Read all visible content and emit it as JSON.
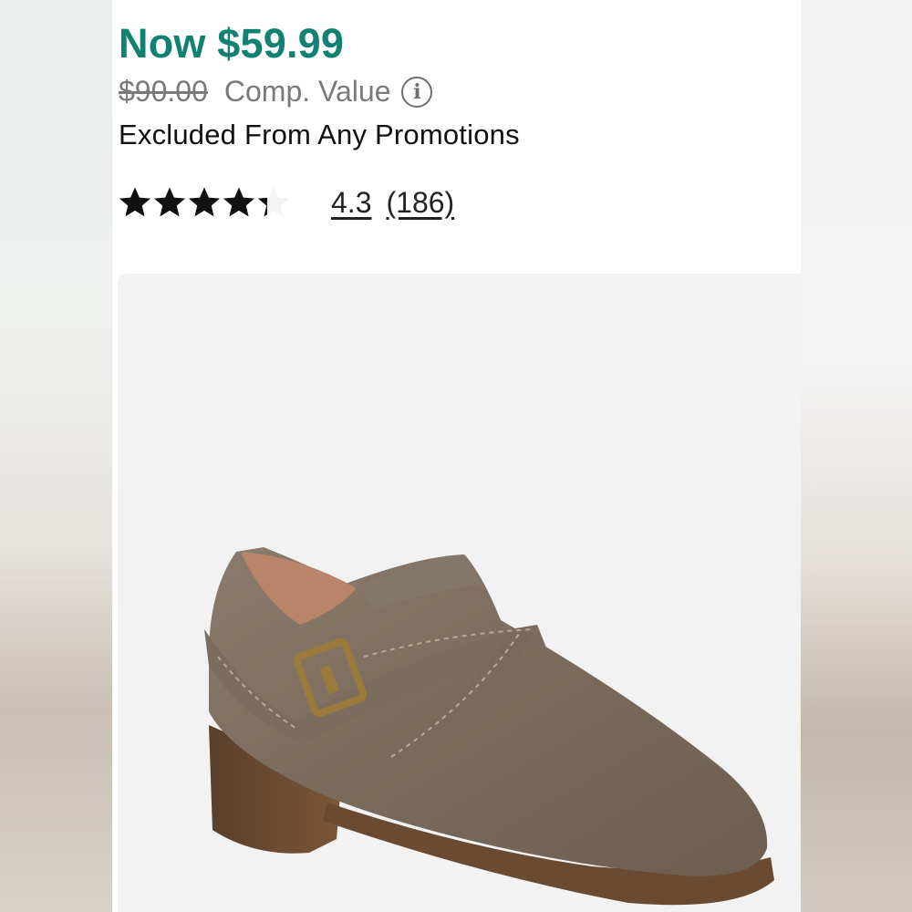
{
  "product": {
    "price_now": "Now $59.99",
    "price_old": "$90.00",
    "comp_value_label": "Comp. Value",
    "info_icon": "info-icon",
    "promo_note": "Excluded From Any Promotions",
    "rating": {
      "stars": 4.3,
      "max_stars": 5,
      "value_text": "4.3",
      "count_text": "(186)"
    },
    "image_icon": "ankle-bootie-image"
  },
  "colors": {
    "price_green": "#118271",
    "text_gray": "#7a7a7a",
    "image_bg": "#f2f2f2"
  }
}
